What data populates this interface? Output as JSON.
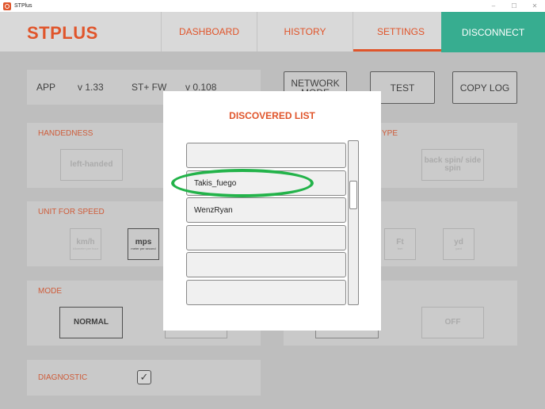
{
  "window": {
    "title": "STPlus",
    "minimize": "–",
    "maximize": "☐",
    "close": "✕"
  },
  "header": {
    "brand": "STPLUS",
    "nav": [
      {
        "label": "DASHBOARD"
      },
      {
        "label": "HISTORY"
      },
      {
        "label": "SETTINGS",
        "active": true
      }
    ],
    "disconnect": "DISCONNECT"
  },
  "info": {
    "app_label": "APP",
    "app_version": "v 1.33",
    "fw_label": "ST+ FW",
    "fw_version": "v 0.108"
  },
  "buttons": {
    "network_mode": "NETWORK MODE",
    "test": "TEST",
    "copy_log": "COPY LOG"
  },
  "handedness": {
    "label": "HANDEDNESS",
    "left": "left-handed"
  },
  "type_panel": {
    "label_fragment": "YPE",
    "option": "back spin/ side spin"
  },
  "speed": {
    "label": "UNIT FOR SPEED",
    "kmh": "km/h",
    "kmh_sub": "kilometer per hour",
    "mps": "mps",
    "mps_sub": "meter per second"
  },
  "distance": {
    "ft": "Ft",
    "ft_sub": "feet",
    "yd": "yd",
    "yd_sub": "yard"
  },
  "mode": {
    "label": "MODE",
    "normal": "NORMAL",
    "off": "OFF"
  },
  "diagnostic": {
    "label": "DIAGNOSTIC",
    "check": "✓"
  },
  "modal": {
    "title": "DISCOVERED LIST",
    "items": [
      "",
      "Takis_fuego",
      "WenzRyan",
      "",
      "",
      ""
    ]
  }
}
